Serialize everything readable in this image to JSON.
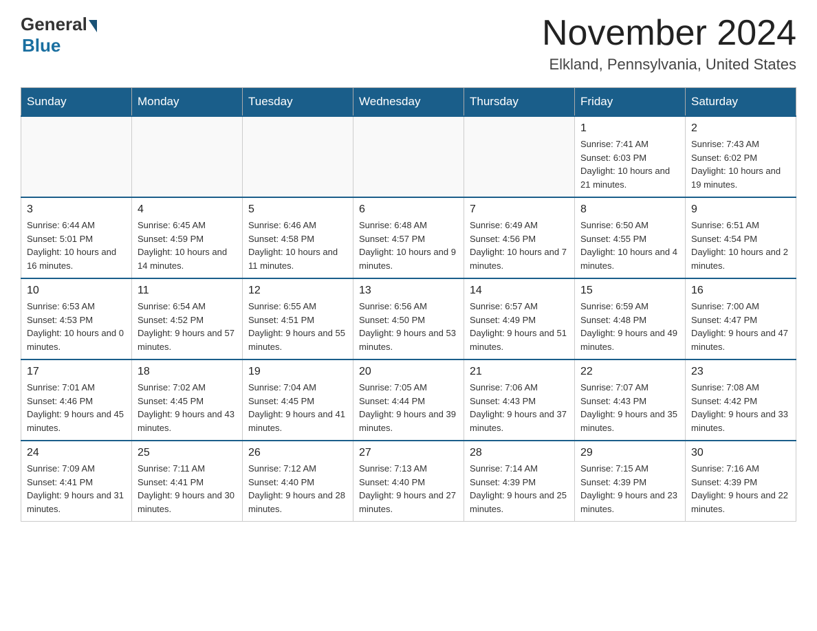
{
  "header": {
    "logo_general": "General",
    "logo_blue": "Blue",
    "month_title": "November 2024",
    "location": "Elkland, Pennsylvania, United States"
  },
  "weekdays": [
    "Sunday",
    "Monday",
    "Tuesday",
    "Wednesday",
    "Thursday",
    "Friday",
    "Saturday"
  ],
  "weeks": [
    [
      {
        "day": "",
        "sunrise": "",
        "sunset": "",
        "daylight": ""
      },
      {
        "day": "",
        "sunrise": "",
        "sunset": "",
        "daylight": ""
      },
      {
        "day": "",
        "sunrise": "",
        "sunset": "",
        "daylight": ""
      },
      {
        "day": "",
        "sunrise": "",
        "sunset": "",
        "daylight": ""
      },
      {
        "day": "",
        "sunrise": "",
        "sunset": "",
        "daylight": ""
      },
      {
        "day": "1",
        "sunrise": "Sunrise: 7:41 AM",
        "sunset": "Sunset: 6:03 PM",
        "daylight": "Daylight: 10 hours and 21 minutes."
      },
      {
        "day": "2",
        "sunrise": "Sunrise: 7:43 AM",
        "sunset": "Sunset: 6:02 PM",
        "daylight": "Daylight: 10 hours and 19 minutes."
      }
    ],
    [
      {
        "day": "3",
        "sunrise": "Sunrise: 6:44 AM",
        "sunset": "Sunset: 5:01 PM",
        "daylight": "Daylight: 10 hours and 16 minutes."
      },
      {
        "day": "4",
        "sunrise": "Sunrise: 6:45 AM",
        "sunset": "Sunset: 4:59 PM",
        "daylight": "Daylight: 10 hours and 14 minutes."
      },
      {
        "day": "5",
        "sunrise": "Sunrise: 6:46 AM",
        "sunset": "Sunset: 4:58 PM",
        "daylight": "Daylight: 10 hours and 11 minutes."
      },
      {
        "day": "6",
        "sunrise": "Sunrise: 6:48 AM",
        "sunset": "Sunset: 4:57 PM",
        "daylight": "Daylight: 10 hours and 9 minutes."
      },
      {
        "day": "7",
        "sunrise": "Sunrise: 6:49 AM",
        "sunset": "Sunset: 4:56 PM",
        "daylight": "Daylight: 10 hours and 7 minutes."
      },
      {
        "day": "8",
        "sunrise": "Sunrise: 6:50 AM",
        "sunset": "Sunset: 4:55 PM",
        "daylight": "Daylight: 10 hours and 4 minutes."
      },
      {
        "day": "9",
        "sunrise": "Sunrise: 6:51 AM",
        "sunset": "Sunset: 4:54 PM",
        "daylight": "Daylight: 10 hours and 2 minutes."
      }
    ],
    [
      {
        "day": "10",
        "sunrise": "Sunrise: 6:53 AM",
        "sunset": "Sunset: 4:53 PM",
        "daylight": "Daylight: 10 hours and 0 minutes."
      },
      {
        "day": "11",
        "sunrise": "Sunrise: 6:54 AM",
        "sunset": "Sunset: 4:52 PM",
        "daylight": "Daylight: 9 hours and 57 minutes."
      },
      {
        "day": "12",
        "sunrise": "Sunrise: 6:55 AM",
        "sunset": "Sunset: 4:51 PM",
        "daylight": "Daylight: 9 hours and 55 minutes."
      },
      {
        "day": "13",
        "sunrise": "Sunrise: 6:56 AM",
        "sunset": "Sunset: 4:50 PM",
        "daylight": "Daylight: 9 hours and 53 minutes."
      },
      {
        "day": "14",
        "sunrise": "Sunrise: 6:57 AM",
        "sunset": "Sunset: 4:49 PM",
        "daylight": "Daylight: 9 hours and 51 minutes."
      },
      {
        "day": "15",
        "sunrise": "Sunrise: 6:59 AM",
        "sunset": "Sunset: 4:48 PM",
        "daylight": "Daylight: 9 hours and 49 minutes."
      },
      {
        "day": "16",
        "sunrise": "Sunrise: 7:00 AM",
        "sunset": "Sunset: 4:47 PM",
        "daylight": "Daylight: 9 hours and 47 minutes."
      }
    ],
    [
      {
        "day": "17",
        "sunrise": "Sunrise: 7:01 AM",
        "sunset": "Sunset: 4:46 PM",
        "daylight": "Daylight: 9 hours and 45 minutes."
      },
      {
        "day": "18",
        "sunrise": "Sunrise: 7:02 AM",
        "sunset": "Sunset: 4:45 PM",
        "daylight": "Daylight: 9 hours and 43 minutes."
      },
      {
        "day": "19",
        "sunrise": "Sunrise: 7:04 AM",
        "sunset": "Sunset: 4:45 PM",
        "daylight": "Daylight: 9 hours and 41 minutes."
      },
      {
        "day": "20",
        "sunrise": "Sunrise: 7:05 AM",
        "sunset": "Sunset: 4:44 PM",
        "daylight": "Daylight: 9 hours and 39 minutes."
      },
      {
        "day": "21",
        "sunrise": "Sunrise: 7:06 AM",
        "sunset": "Sunset: 4:43 PM",
        "daylight": "Daylight: 9 hours and 37 minutes."
      },
      {
        "day": "22",
        "sunrise": "Sunrise: 7:07 AM",
        "sunset": "Sunset: 4:43 PM",
        "daylight": "Daylight: 9 hours and 35 minutes."
      },
      {
        "day": "23",
        "sunrise": "Sunrise: 7:08 AM",
        "sunset": "Sunset: 4:42 PM",
        "daylight": "Daylight: 9 hours and 33 minutes."
      }
    ],
    [
      {
        "day": "24",
        "sunrise": "Sunrise: 7:09 AM",
        "sunset": "Sunset: 4:41 PM",
        "daylight": "Daylight: 9 hours and 31 minutes."
      },
      {
        "day": "25",
        "sunrise": "Sunrise: 7:11 AM",
        "sunset": "Sunset: 4:41 PM",
        "daylight": "Daylight: 9 hours and 30 minutes."
      },
      {
        "day": "26",
        "sunrise": "Sunrise: 7:12 AM",
        "sunset": "Sunset: 4:40 PM",
        "daylight": "Daylight: 9 hours and 28 minutes."
      },
      {
        "day": "27",
        "sunrise": "Sunrise: 7:13 AM",
        "sunset": "Sunset: 4:40 PM",
        "daylight": "Daylight: 9 hours and 27 minutes."
      },
      {
        "day": "28",
        "sunrise": "Sunrise: 7:14 AM",
        "sunset": "Sunset: 4:39 PM",
        "daylight": "Daylight: 9 hours and 25 minutes."
      },
      {
        "day": "29",
        "sunrise": "Sunrise: 7:15 AM",
        "sunset": "Sunset: 4:39 PM",
        "daylight": "Daylight: 9 hours and 23 minutes."
      },
      {
        "day": "30",
        "sunrise": "Sunrise: 7:16 AM",
        "sunset": "Sunset: 4:39 PM",
        "daylight": "Daylight: 9 hours and 22 minutes."
      }
    ]
  ]
}
